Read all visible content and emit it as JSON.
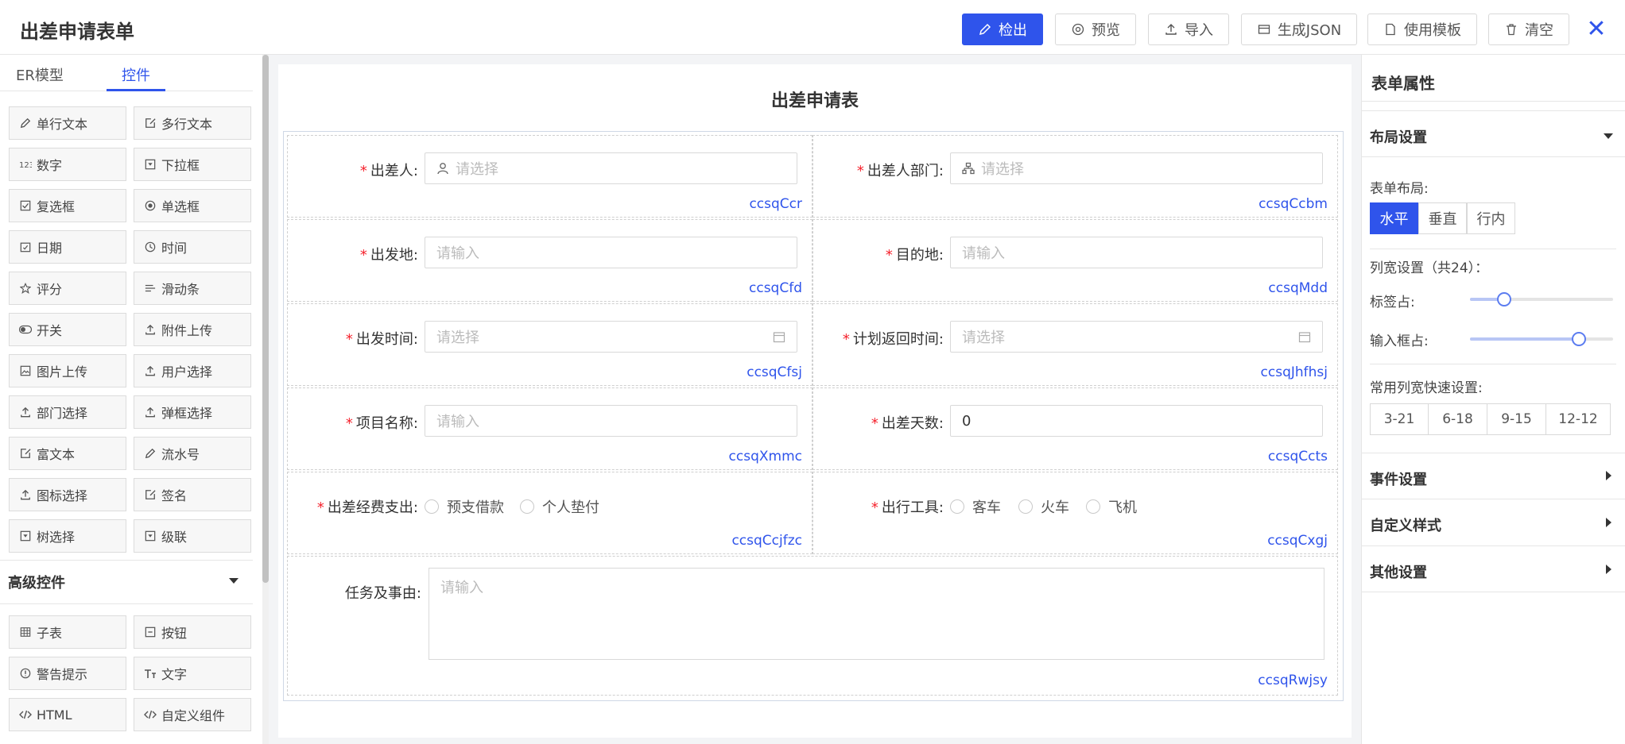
{
  "header": {
    "title": "出差申请表单",
    "buttons": {
      "check": "检出",
      "preview": "预览",
      "import": "导入",
      "gen_json": "生成JSON",
      "template": "使用模板",
      "clear": "清空"
    },
    "close": "✕"
  },
  "left_panel": {
    "tabs": [
      "ER模型",
      "控件"
    ],
    "active_tab": "控件",
    "controls": [
      {
        "label": "单行文本",
        "icon": "pencil-icon"
      },
      {
        "label": "多行文本",
        "icon": "edit-box-icon"
      },
      {
        "label": "数字",
        "icon": "number-icon"
      },
      {
        "label": "下拉框",
        "icon": "dropdown-icon"
      },
      {
        "label": "复选框",
        "icon": "checkbox-icon"
      },
      {
        "label": "单选框",
        "icon": "radio-icon"
      },
      {
        "label": "日期",
        "icon": "date-icon"
      },
      {
        "label": "时间",
        "icon": "clock-icon"
      },
      {
        "label": "评分",
        "icon": "star-icon"
      },
      {
        "label": "滑动条",
        "icon": "slider-icon"
      },
      {
        "label": "开关",
        "icon": "switch-icon"
      },
      {
        "label": "附件上传",
        "icon": "upload-icon"
      },
      {
        "label": "图片上传",
        "icon": "image-icon"
      },
      {
        "label": "用户选择",
        "icon": "upload-icon"
      },
      {
        "label": "部门选择",
        "icon": "upload-icon"
      },
      {
        "label": "弹框选择",
        "icon": "upload-icon"
      },
      {
        "label": "富文本",
        "icon": "edit-box-icon"
      },
      {
        "label": "流水号",
        "icon": "pencil-icon"
      },
      {
        "label": "图标选择",
        "icon": "upload-icon"
      },
      {
        "label": "签名",
        "icon": "edit-box-icon"
      },
      {
        "label": "树选择",
        "icon": "dropdown-icon"
      },
      {
        "label": "级联",
        "icon": "dropdown-icon"
      }
    ],
    "advanced_title": "高级控件",
    "advanced_controls": [
      {
        "label": "子表",
        "icon": "table-icon"
      },
      {
        "label": "按钮",
        "icon": "button-icon"
      },
      {
        "label": "警告提示",
        "icon": "alert-icon"
      },
      {
        "label": "文字",
        "icon": "text-icon"
      },
      {
        "label": "HTML",
        "icon": "code-icon"
      },
      {
        "label": "自定义组件",
        "icon": "code-icon"
      }
    ]
  },
  "form": {
    "title": "出差申请表",
    "fields": {
      "applicant": {
        "label": "出差人:",
        "placeholder": "请选择",
        "id": "ccsqCcr"
      },
      "dept": {
        "label": "出差人部门:",
        "placeholder": "请选择",
        "id": "ccsqCcbm"
      },
      "from": {
        "label": "出发地:",
        "placeholder": "请输入",
        "id": "ccsqCfd"
      },
      "dest": {
        "label": "目的地:",
        "placeholder": "请输入",
        "id": "ccsqMdd"
      },
      "depart_time": {
        "label": "出发时间:",
        "placeholder": "请选择",
        "id": "ccsqCfsj"
      },
      "return_time": {
        "label": "计划返回时间:",
        "placeholder": "请选择",
        "id": "ccsqJhfhsj"
      },
      "project": {
        "label": "项目名称:",
        "placeholder": "请输入",
        "id": "ccsqXmmc"
      },
      "days": {
        "label": "出差天数:",
        "value": "0",
        "id": "ccsqCcts"
      },
      "expense": {
        "label": "出差经费支出:",
        "options": [
          "预支借款",
          "个人垫付"
        ],
        "id": "ccsqCcjfzc"
      },
      "transport": {
        "label": "出行工具:",
        "options": [
          "客车",
          "火车",
          "飞机"
        ],
        "id": "ccsqCxgj"
      },
      "reason": {
        "label": "任务及事由:",
        "placeholder": "请输入",
        "id": "ccsqRwjsy"
      }
    },
    "required_mark": "*"
  },
  "right_panel": {
    "title": "表单属性",
    "layout_section": "布局设置",
    "form_layout_label": "表单布局:",
    "layout_options": [
      "水平",
      "垂直",
      "行内"
    ],
    "layout_selected": "水平",
    "col_width_label": "列宽设置（共24）：",
    "label_span_label": "标签占:",
    "input_span_label": "输入框占:",
    "label_span_value": 0.24,
    "input_span_value": 0.76,
    "quick_label": "常用列宽快速设置:",
    "quick_options": [
      "3-21",
      "6-18",
      "9-15",
      "12-12"
    ],
    "event_section": "事件设置",
    "style_section": "自定义样式",
    "other_section": "其他设置"
  }
}
